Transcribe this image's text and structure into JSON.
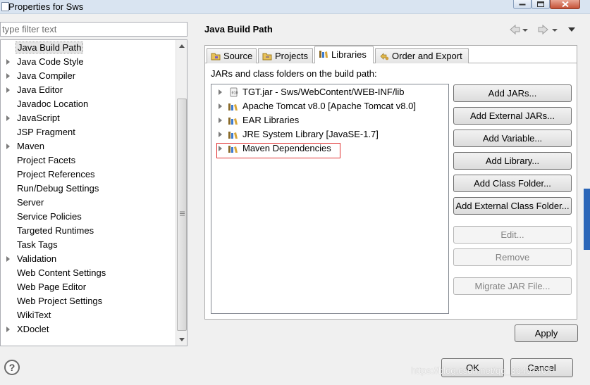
{
  "window": {
    "title": "Properties for Sws"
  },
  "filter": {
    "placeholder": "type filter text"
  },
  "tree": {
    "items": [
      {
        "label": "Java Build Path",
        "expandable": false,
        "selected": true
      },
      {
        "label": "Java Code Style",
        "expandable": true
      },
      {
        "label": "Java Compiler",
        "expandable": true
      },
      {
        "label": "Java Editor",
        "expandable": true
      },
      {
        "label": "Javadoc Location",
        "expandable": false
      },
      {
        "label": "JavaScript",
        "expandable": true
      },
      {
        "label": "JSP Fragment",
        "expandable": false
      },
      {
        "label": "Maven",
        "expandable": true
      },
      {
        "label": "Project Facets",
        "expandable": false
      },
      {
        "label": "Project References",
        "expandable": false
      },
      {
        "label": "Run/Debug Settings",
        "expandable": false
      },
      {
        "label": "Server",
        "expandable": false
      },
      {
        "label": "Service Policies",
        "expandable": false
      },
      {
        "label": "Targeted Runtimes",
        "expandable": false
      },
      {
        "label": "Task Tags",
        "expandable": false
      },
      {
        "label": "Validation",
        "expandable": true
      },
      {
        "label": "Web Content Settings",
        "expandable": false
      },
      {
        "label": "Web Page Editor",
        "expandable": false
      },
      {
        "label": "Web Project Settings",
        "expandable": false
      },
      {
        "label": "WikiText",
        "expandable": false
      },
      {
        "label": "XDoclet",
        "expandable": true
      }
    ]
  },
  "page": {
    "title": "Java Build Path",
    "tabs": [
      {
        "label": "Source",
        "icon": "source-folder-icon",
        "active": false
      },
      {
        "label": "Projects",
        "icon": "projects-icon",
        "active": false
      },
      {
        "label": "Libraries",
        "icon": "libraries-icon",
        "active": true
      },
      {
        "label": "Order and Export",
        "icon": "order-export-icon",
        "active": false
      }
    ],
    "section_label": "JARs and class folders on the build path:",
    "entries": [
      {
        "label": "TGT.jar - Sws/WebContent/WEB-INF/lib",
        "icon": "jar-icon"
      },
      {
        "label": "Apache Tomcat v8.0 [Apache Tomcat v8.0]",
        "icon": "library-icon"
      },
      {
        "label": "EAR Libraries",
        "icon": "library-icon"
      },
      {
        "label": "JRE System Library [JavaSE-1.7]",
        "icon": "library-icon"
      },
      {
        "label": "Maven Dependencies",
        "icon": "library-icon",
        "highlighted": true
      }
    ],
    "buttons": {
      "add_jars": "Add JARs...",
      "add_external_jars": "Add External JARs...",
      "add_variable": "Add Variable...",
      "add_library": "Add Library...",
      "add_class_folder": "Add Class Folder...",
      "add_external_class_folder": "Add External Class Folder...",
      "edit": "Edit...",
      "remove": "Remove",
      "migrate_jar": "Migrate JAR File..."
    },
    "apply": "Apply"
  },
  "footer": {
    "help": "?",
    "ok": "OK",
    "cancel": "Cancel",
    "watermark": "https://blog.csdn.net/qq_36407464"
  },
  "colors": {
    "highlight_box": "#e03030",
    "selection_bg": "#e5e5e5"
  }
}
